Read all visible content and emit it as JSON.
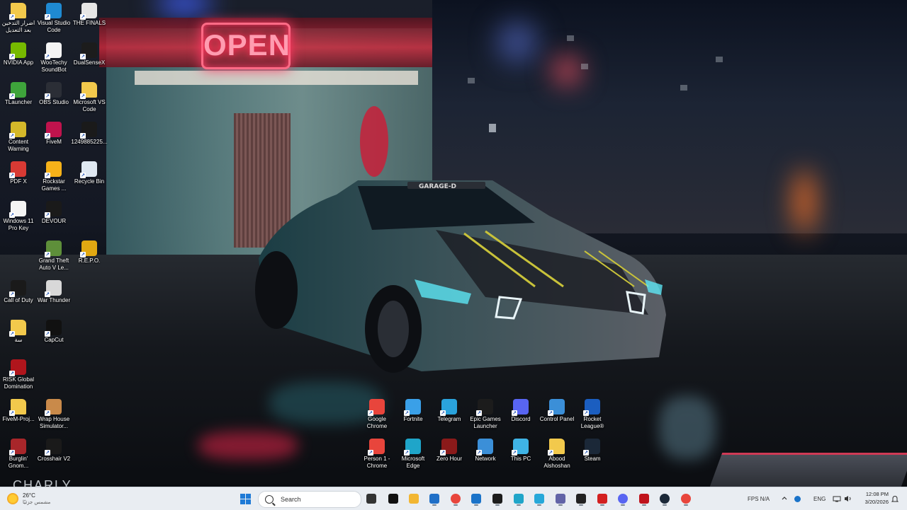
{
  "desktop": {
    "icons": [
      {
        "label": "اضرار التدخين بعد التعديل",
        "icon": "folder-icon",
        "color": "#f2c94c"
      },
      {
        "label": "Visual Studio Code",
        "icon": "vscode-icon",
        "color": "#1f8ad2"
      },
      {
        "label": "THE FINALS",
        "icon": "the-finals-icon",
        "color": "#e6e6e6"
      },
      {
        "label": "NVIDIA App",
        "icon": "nvidia-icon",
        "color": "#76b900"
      },
      {
        "label": "WooTechy SoundBot",
        "icon": "document-icon",
        "color": "#f4f4f4"
      },
      {
        "label": "DualSenseX",
        "icon": "dualsensex-icon",
        "color": "#1c1c1c"
      },
      {
        "label": "TLauncher",
        "icon": "tlauncher-icon",
        "color": "#3ea33b"
      },
      {
        "label": "OBS Studio",
        "icon": "obs-icon",
        "color": "#2b2e36"
      },
      {
        "label": "Microsoft VS Code",
        "icon": "folder-icon",
        "color": "#f2c94c"
      },
      {
        "label": "Content Warning",
        "icon": "content-warning-icon",
        "color": "#d4b82a"
      },
      {
        "label": "FiveM",
        "icon": "fivem-icon",
        "color": "#c0134d"
      },
      {
        "label": "1249885225...",
        "icon": "image-file-icon",
        "color": "#1a1a1a"
      },
      {
        "label": "PDF X",
        "icon": "pdf-x-icon",
        "color": "#d83a34"
      },
      {
        "label": "Rockstar Games ...",
        "icon": "rockstar-icon",
        "color": "#f6b219"
      },
      {
        "label": "Recycle Bin",
        "icon": "recycle-bin-icon",
        "color": "#dfe8f2"
      },
      {
        "label": "Windows 11 Pro Key",
        "icon": "document-icon",
        "color": "#f4f4f4"
      },
      {
        "label": "DEVOUR",
        "icon": "devour-icon",
        "color": "#1a1a1a"
      },
      {
        "label": "Grand Theft Auto V Le...",
        "icon": "gta-v-icon",
        "color": "#5e8f3a"
      },
      {
        "label": "R.E.P.O.",
        "icon": "repo-icon",
        "color": "#e1a812"
      },
      {
        "label": "Call of Duty",
        "icon": "call-of-duty-icon",
        "color": "#1a1a1a"
      },
      {
        "label": "War Thunder",
        "icon": "war-thunder-icon",
        "color": "#d8d8d8"
      },
      {
        "label": "سة",
        "icon": "folder-icon",
        "color": "#f2c94c"
      },
      {
        "label": "CapCut",
        "icon": "capcut-icon",
        "color": "#111111"
      },
      {
        "label": "RISK Global Domination",
        "icon": "risk-icon",
        "color": "#b0151c"
      },
      {
        "label": "FiveM-Proj...",
        "icon": "folder-icon",
        "color": "#f2c94c"
      },
      {
        "label": "Wrap House Simulator...",
        "icon": "wrap-house-icon",
        "color": "#c98a4a"
      },
      {
        "label": "Burglin' Gnom...",
        "icon": "burglin-gnomes-icon",
        "color": "#a8262a"
      },
      {
        "label": "Crosshair V2",
        "icon": "crosshair-icon",
        "color": "#1a1a1a"
      },
      {
        "label": "Google Chrome",
        "icon": "chrome-icon",
        "color": "#e8453c"
      },
      {
        "label": "Fortnite",
        "icon": "fortnite-icon",
        "color": "#3aa0e8"
      },
      {
        "label": "Telegram",
        "icon": "telegram-icon",
        "color": "#2aa3dc"
      },
      {
        "label": "Epic Games Launcher",
        "icon": "epic-games-icon",
        "color": "#1c1c1c"
      },
      {
        "label": "Discord",
        "icon": "discord-icon",
        "color": "#5865f2"
      },
      {
        "label": "Control Panel",
        "icon": "control-panel-icon",
        "color": "#3b8fd8"
      },
      {
        "label": "Rocket League®",
        "icon": "rocket-league-icon",
        "color": "#1b5ec0"
      },
      {
        "label": "Person 1 - Chrome",
        "icon": "chrome-icon",
        "color": "#e8453c"
      },
      {
        "label": "Microsoft Edge",
        "icon": "edge-icon",
        "color": "#1fa5c9"
      },
      {
        "label": "Zero Hour",
        "icon": "zero-hour-icon",
        "color": "#8a1a1a"
      },
      {
        "label": "Network",
        "icon": "network-icon",
        "color": "#3b8fd8"
      },
      {
        "label": "This PC",
        "icon": "this-pc-icon",
        "color": "#3fb4e6"
      },
      {
        "label": "Abood Alshoshan",
        "icon": "folder-icon",
        "color": "#f2c94c"
      },
      {
        "label": "Steam",
        "icon": "steam-icon",
        "color": "#1b2838"
      }
    ],
    "wallpaper": {
      "sign_text": "OPEN",
      "car_plate": "GARAGE-D",
      "corner_text": "CHARLY"
    }
  },
  "taskbar": {
    "weather": {
      "temp": "26°C",
      "condition": "مشمس جزئيًا"
    },
    "search_placeholder": "Search",
    "pinned": [
      {
        "name": "task-view-icon",
        "color": "#333333"
      },
      {
        "name": "capcut-taskbar-icon",
        "color": "#111111"
      },
      {
        "name": "file-explorer-icon",
        "color": "#f2b632"
      },
      {
        "name": "media-player-icon",
        "color": "#1f6fc7"
      },
      {
        "name": "chrome-taskbar-icon",
        "color": "#e8453c"
      },
      {
        "name": "outlook-icon",
        "color": "#1a73c9"
      },
      {
        "name": "epic-taskbar-icon",
        "color": "#1c1c1c"
      },
      {
        "name": "edge-taskbar-icon",
        "color": "#1fa5c9"
      },
      {
        "name": "copilot-icon",
        "color": "#26a8d9"
      },
      {
        "name": "teams-icon",
        "color": "#6264a7"
      },
      {
        "name": "capcut-pinned-icon",
        "color": "#222222"
      },
      {
        "name": "rockstar-taskbar-icon",
        "color": "#d32020"
      },
      {
        "name": "discord-taskbar-icon",
        "color": "#5865f2"
      },
      {
        "name": "app-badge-icon",
        "color": "#c0131c"
      },
      {
        "name": "steam-taskbar-icon",
        "color": "#1b2838"
      },
      {
        "name": "chrome-profile-icon",
        "color": "#e8453c"
      }
    ],
    "tray": {
      "fps_label": "FPS",
      "fps_value": "N/A",
      "language": "ENG",
      "time": "12:08 PM",
      "date": "3/20/2026"
    }
  },
  "colors": {
    "taskbar_bg": "#e9edf2",
    "accent": "#1f7ad6"
  }
}
